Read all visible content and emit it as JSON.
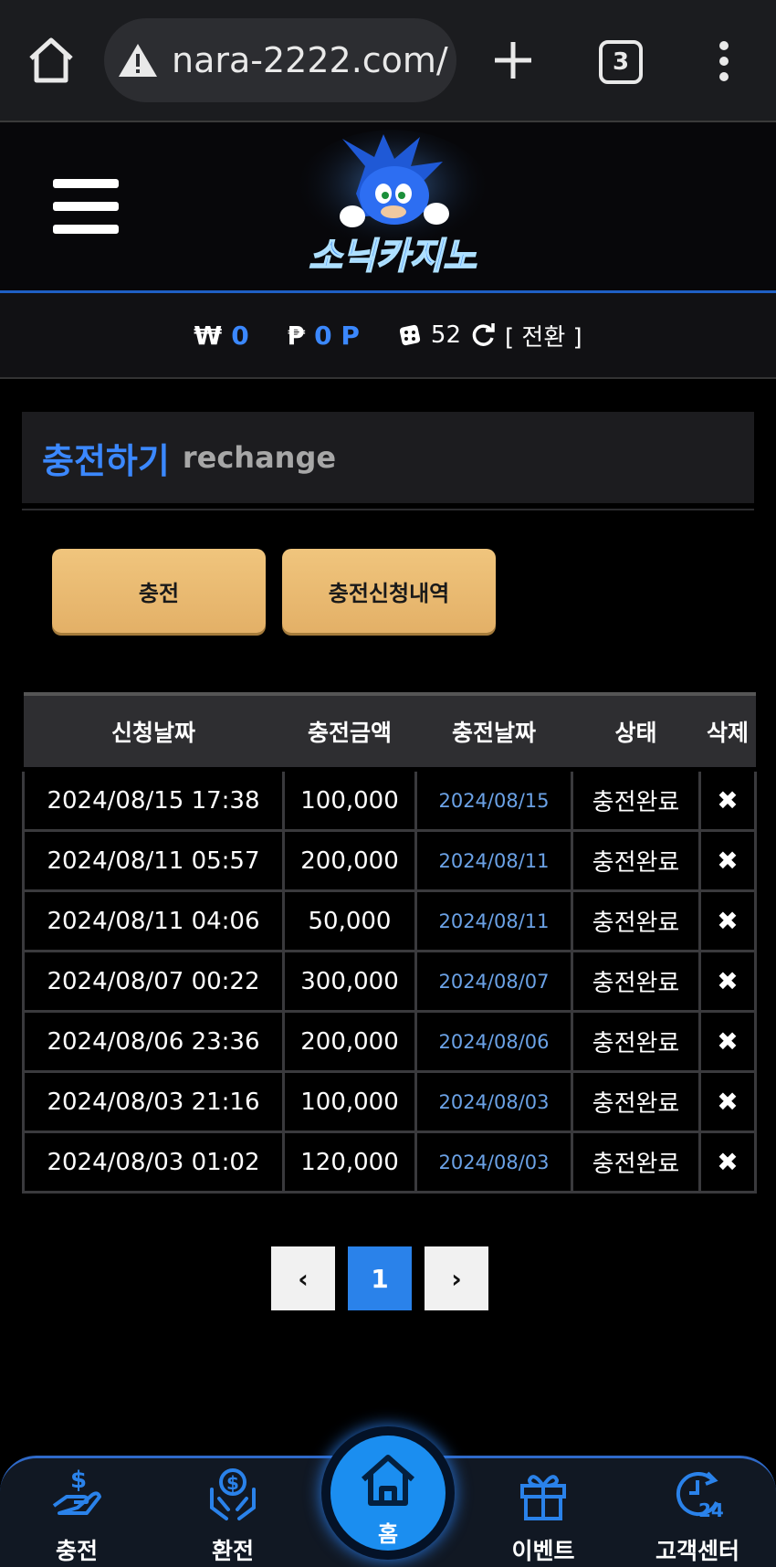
{
  "browser": {
    "url": "nara-2222.com/",
    "tab_count": "3"
  },
  "site": {
    "logo_text": "소닉카지노"
  },
  "balance": {
    "won_symbol": "₩",
    "won_value": "0",
    "point_symbol": "₱",
    "point_value": "0 P",
    "dice_value": "52",
    "switch_label": "[ 전환 ]"
  },
  "section": {
    "title_ko": "충전하기",
    "title_en": "rechange"
  },
  "buttons": {
    "charge": "충전",
    "history": "충전신청내역"
  },
  "table": {
    "headers": [
      "신청날짜",
      "충전금액",
      "충전날짜",
      "상태",
      "삭제"
    ],
    "rows": [
      [
        "2024/08/15 17:38",
        "100,000",
        "2024/08/15",
        "충전완료",
        "✖"
      ],
      [
        "2024/08/11 05:57",
        "200,000",
        "2024/08/11",
        "충전완료",
        "✖"
      ],
      [
        "2024/08/11 04:06",
        "50,000",
        "2024/08/11",
        "충전완료",
        "✖"
      ],
      [
        "2024/08/07 00:22",
        "300,000",
        "2024/08/07",
        "충전완료",
        "✖"
      ],
      [
        "2024/08/06 23:36",
        "200,000",
        "2024/08/06",
        "충전완료",
        "✖"
      ],
      [
        "2024/08/03 21:16",
        "100,000",
        "2024/08/03",
        "충전완료",
        "✖"
      ],
      [
        "2024/08/03 01:02",
        "120,000",
        "2024/08/03",
        "충전완료",
        "✖"
      ]
    ]
  },
  "pagination": {
    "prev": "‹",
    "current": "1",
    "next": "›"
  },
  "bottom_nav": {
    "charge": "충전",
    "exchange": "환전",
    "home": "홈",
    "event": "이벤트",
    "support": "고객센터"
  },
  "colors": {
    "accent_blue": "#3b88ff",
    "button_gold": "#e9b970",
    "link_blue": "#6ba2e6"
  }
}
